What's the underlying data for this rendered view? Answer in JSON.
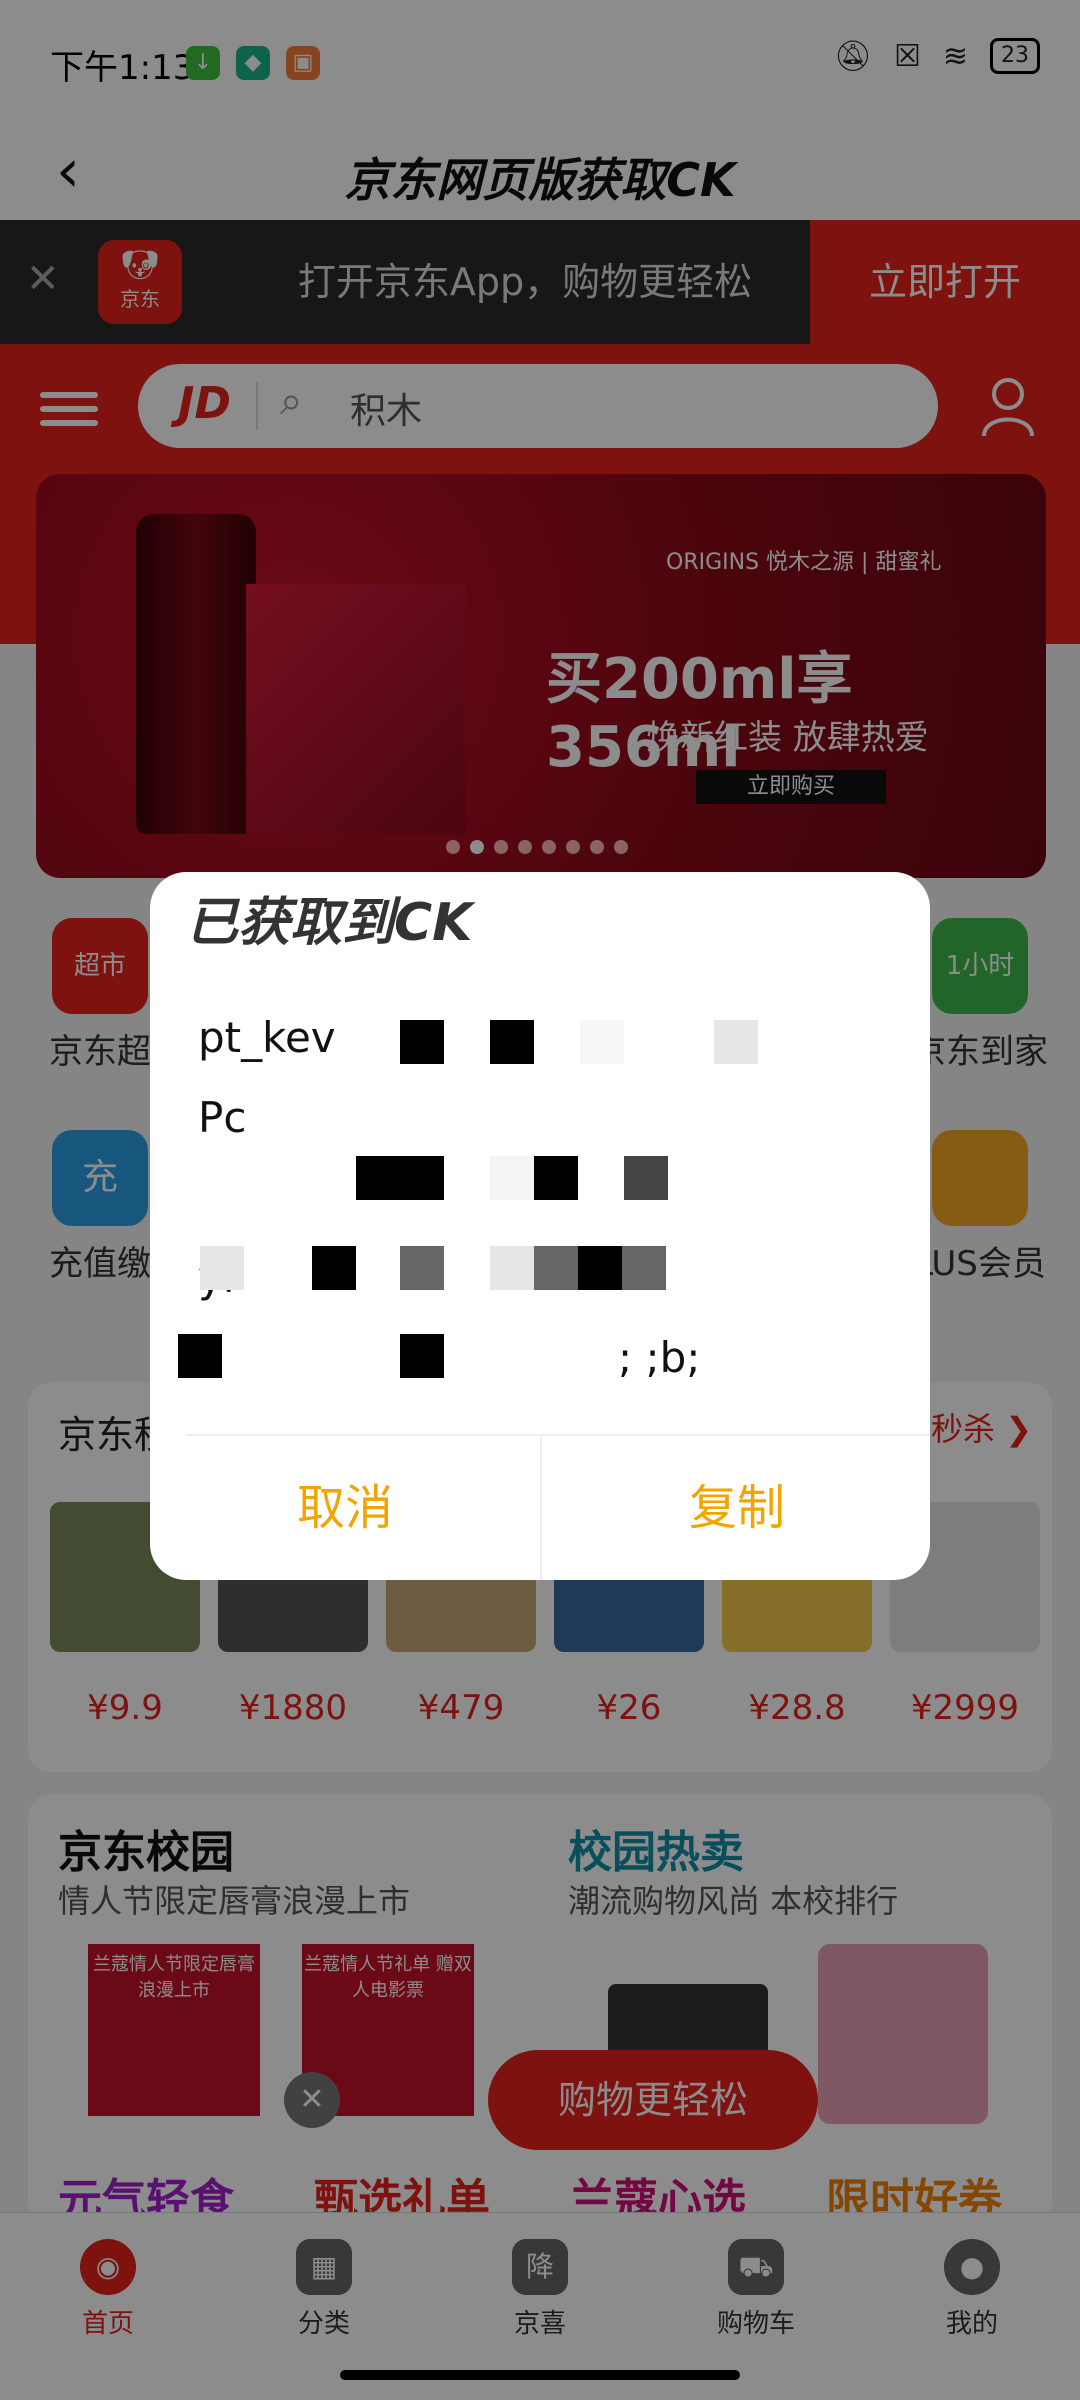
{
  "status_bar": {
    "time": "下午1:13",
    "battery": "23"
  },
  "app_title": "京东网页版获取CK",
  "open_app_bar": {
    "text": "打开京东App，购物更轻松",
    "button": "立即打开",
    "logo_text": "京东"
  },
  "search": {
    "logo": "JD",
    "placeholder": "积木"
  },
  "banner": {
    "brand": "ORIGINS 悦木之源 | 甜蜜礼",
    "headline": "买200ml享356ml",
    "sub": "焕新红装 放肆热爱",
    "button": "立即购买"
  },
  "categories": [
    {
      "label": "京东超",
      "badge": "超市"
    },
    {
      "label": "京东到家",
      "badge": "1小时"
    },
    {
      "label": "充值缴",
      "badge": "充"
    },
    {
      "label": "LUS会员",
      "badge": ""
    }
  ],
  "seckill": {
    "title": "京东秒",
    "more": "秒杀",
    "prices": [
      "¥9.9",
      "¥1880",
      "¥479",
      "¥26",
      "¥28.8",
      "¥2999"
    ]
  },
  "campus": {
    "left_title": "京东校园",
    "left_sub": "情人节限定唇膏浪漫上市",
    "right_title": "校园热卖",
    "right_sub": "潮流购物风尚 本校排行",
    "img1": "兰蔻情人节限定唇膏 浪漫上市",
    "img2": "兰蔻情人节礼单 赠双人电影票",
    "float_btn": "购物更轻松",
    "sections": [
      "元气轻食",
      "甄选礼单",
      "兰蔻心选",
      "限时好券"
    ]
  },
  "tabbar": [
    "首页",
    "分类",
    "京喜",
    "购物车",
    "我的"
  ],
  "dialog": {
    "title": "已获取到CK",
    "lines": [
      "pt_kev",
      "Pc",
      "",
      "yl",
      "; ;b;"
    ],
    "cancel": "取消",
    "copy": "复制"
  },
  "colors": {
    "jd_red": "#e3211b",
    "dialog_button": "#f0a500"
  }
}
